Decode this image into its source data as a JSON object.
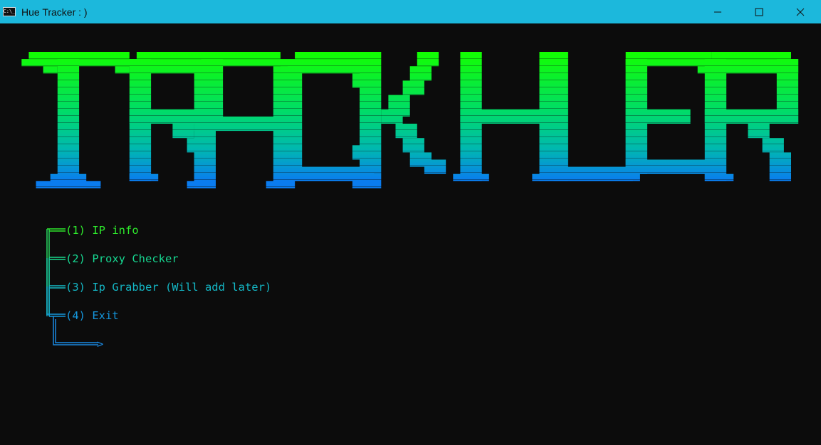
{
  "window": {
    "title": "Hue Tracker : )",
    "icon_label": "C:\\_",
    "controls": [
      "minimize-icon",
      "maximize-icon",
      "close-icon"
    ]
  },
  "banner": {
    "text": "TRACK HUER",
    "gradient_top": "#13ff00",
    "gradient_bottom": "#0a7cf0"
  },
  "menu": {
    "items": [
      {
        "label": "(1) IP info",
        "color": "#2ee92c"
      },
      {
        "label": "(2) Proxy Checker",
        "color": "#16d690"
      },
      {
        "label": "(3) Ip Grabber (Will add later)",
        "color": "#14b6c4"
      },
      {
        "label": "(4) Exit",
        "color": "#1596dc"
      }
    ],
    "prompt": ">",
    "prompt_color": "#1a88e0"
  },
  "colors": {
    "titlebar": "#1cb8dc",
    "console_bg": "#0c0c0c"
  }
}
